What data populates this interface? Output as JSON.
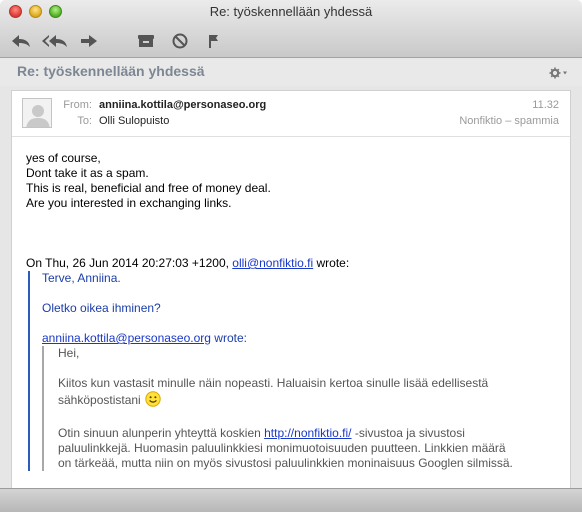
{
  "window": {
    "title": "Re: työskennellään yhdessä"
  },
  "toolbar": {
    "reply_icon": "reply-icon",
    "reply_all_icon": "reply-all-icon",
    "forward_icon": "forward-icon",
    "archive_icon": "archive-icon",
    "junk_icon": "junk-icon",
    "flag_icon": "flag-icon"
  },
  "message": {
    "subject": "Re: työskennellään yhdessä",
    "header": {
      "from_label": "From:",
      "from": "anniina.kottila@personaseo.org",
      "to_label": "To:",
      "to": "Olli Sulopuisto",
      "time": "11.32",
      "folder": "Nonfiktio – spammia"
    },
    "body_lines": [
      "yes of course,",
      "Dont take it as a spam.",
      "This is real, beneficial and free of money deal.",
      "Are you interested in exchanging links."
    ],
    "attribution": {
      "prefix": "On Thu, 26 Jun 2014 20:27:03 +1200, ",
      "link": "olli@nonfiktio.fi",
      "suffix": " wrote:"
    },
    "quote1": {
      "line1": "Terve, Anniina.",
      "line2": "Oletko oikea ihminen?",
      "attribution_link": "anniina.kottila@personaseo.org",
      "attribution_suffix": " wrote:"
    },
    "quote2": {
      "greeting": "Hei,",
      "para1_line1": "Kiitos kun vastasit minulle näin nopeasti. Haluaisin kertoa sinulle lisää edellisestä",
      "para1_line2": "sähköpostistani",
      "para2_line1_prefix": "Otin sinuun alunperin yhteyttä koskien ",
      "para2_link": "http://nonfiktio.fi/",
      "para2_line1_suffix": " -sivustoa ja sivustosi",
      "para2_line2": "paluulinkkejä. Huomasin paluulinkkiesi monimuotoisuuden puutteen. Linkkien määrä",
      "para2_line3": "on tärkeää, mutta niin on myös sivustosi paluulinkkien moninaisuus Googlen silmissä."
    }
  },
  "colors": {
    "link": "#1a38c7",
    "quote1_bar": "#2b5bbb",
    "quote1_text": "#1b3ea8",
    "quote2_bar": "#a8a8a8",
    "quote2_text": "#555555",
    "subject": "#7c8793"
  }
}
